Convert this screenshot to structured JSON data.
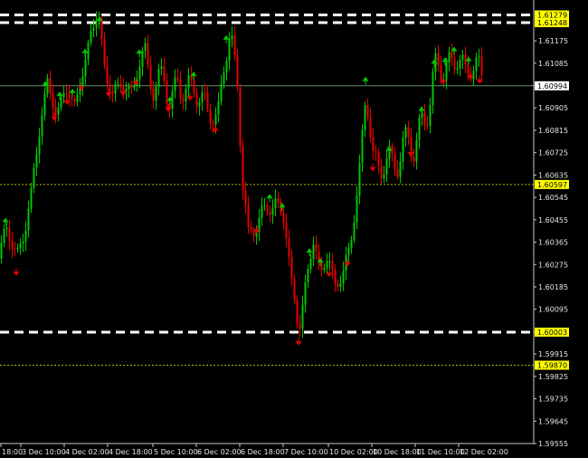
{
  "chart_data": {
    "type": "candlestick",
    "title": "",
    "ylim": [
      1.59555,
      1.6131
    ],
    "y_ticks": [
      "1.61175",
      "1.61085",
      "1.60994",
      "1.60905",
      "1.60815",
      "1.60725",
      "1.60635",
      "1.60545",
      "1.60455",
      "1.60365",
      "1.60275",
      "1.60185",
      "1.60095",
      "1.60003",
      "1.59915",
      "1.59825",
      "1.59735",
      "1.59645",
      "1.59555"
    ],
    "x_ticks": [
      "18:00",
      "3 Dec 10:00",
      "4 Dec 02:00",
      "4 Dec 18:00",
      "5 Dec 10:00",
      "6 Dec 02:00",
      "6 Dec 18:00",
      "7 Dec 10:00",
      "10 Dec 02:00",
      "10 Dec 18:00",
      "11 Dec 10:00",
      "12 Dec 02:00"
    ],
    "horizontal_levels": [
      {
        "value": 1.61279,
        "label": "1.61279",
        "style": "white-dashed"
      },
      {
        "value": 1.61248,
        "label": "1.61248",
        "style": "white-dashed"
      },
      {
        "value": 1.60994,
        "label": "1.60994",
        "style": "current-price"
      },
      {
        "value": 1.60597,
        "label": "1.60597",
        "style": "yellow-dotted"
      },
      {
        "value": 1.60003,
        "label": "1.60003",
        "style": "white-dashed"
      },
      {
        "value": 1.5987,
        "label": "1.59870",
        "style": "yellow-dotted"
      }
    ],
    "path": [
      [
        0,
        1.603
      ],
      [
        8,
        1.6045
      ],
      [
        18,
        1.6028
      ],
      [
        24,
        1.6038
      ],
      [
        34,
        1.6055
      ],
      [
        44,
        1.6085
      ],
      [
        52,
        1.61
      ],
      [
        62,
        1.6088
      ],
      [
        72,
        1.6098
      ],
      [
        82,
        1.6092
      ],
      [
        92,
        1.6105
      ],
      [
        100,
        1.6122
      ],
      [
        108,
        1.6128
      ],
      [
        116,
        1.6105
      ],
      [
        124,
        1.6095
      ],
      [
        134,
        1.6102
      ],
      [
        144,
        1.6094
      ],
      [
        152,
        1.6108
      ],
      [
        160,
        1.6112
      ],
      [
        170,
        1.6096
      ],
      [
        180,
        1.6106
      ],
      [
        188,
        1.609
      ],
      [
        196,
        1.6102
      ],
      [
        204,
        1.6096
      ],
      [
        214,
        1.61
      ],
      [
        222,
        1.6092
      ],
      [
        232,
        1.609
      ],
      [
        240,
        1.6084
      ],
      [
        248,
        1.6112
      ],
      [
        254,
        1.612
      ],
      [
        262,
        1.61
      ],
      [
        268,
        1.606
      ],
      [
        274,
        1.6038
      ],
      [
        284,
        1.6045
      ],
      [
        294,
        1.605
      ],
      [
        304,
        1.6052
      ],
      [
        314,
        1.6046
      ],
      [
        322,
        1.602
      ],
      [
        330,
        1.6
      ],
      [
        338,
        1.6022
      ],
      [
        346,
        1.6036
      ],
      [
        354,
        1.6025
      ],
      [
        362,
        1.603
      ],
      [
        370,
        1.602
      ],
      [
        378,
        1.6022
      ],
      [
        386,
        1.6035
      ],
      [
        396,
        1.606
      ],
      [
        404,
        1.6098
      ],
      [
        412,
        1.607
      ],
      [
        420,
        1.6066
      ],
      [
        430,
        1.607
      ],
      [
        440,
        1.6068
      ],
      [
        450,
        1.608
      ],
      [
        458,
        1.6072
      ],
      [
        466,
        1.6086
      ],
      [
        474,
        1.609
      ],
      [
        482,
        1.611
      ],
      [
        490,
        1.6105
      ],
      [
        498,
        1.6108
      ],
      [
        506,
        1.6112
      ],
      [
        514,
        1.6104
      ],
      [
        522,
        1.6108
      ],
      [
        528,
        1.6108
      ],
      [
        534,
        1.61
      ]
    ],
    "up_fractal_x": [
      6,
      50,
      66,
      80,
      94,
      110,
      154,
      188,
      214,
      250,
      298,
      312,
      342,
      354,
      404,
      430,
      466,
      480,
      492,
      502,
      518
    ],
    "down_fractal_x": [
      18,
      60,
      74,
      90,
      120,
      136,
      150,
      186,
      210,
      238,
      284,
      330,
      364,
      384,
      412,
      454,
      490,
      520,
      530
    ],
    "colors": {
      "up": "#00c800",
      "down": "#e60000",
      "level_label_bg": "#ffff00",
      "dashed_line": "#ffffff",
      "dotted_line": "#b4b400",
      "current_line": "#6b8e6b"
    }
  }
}
